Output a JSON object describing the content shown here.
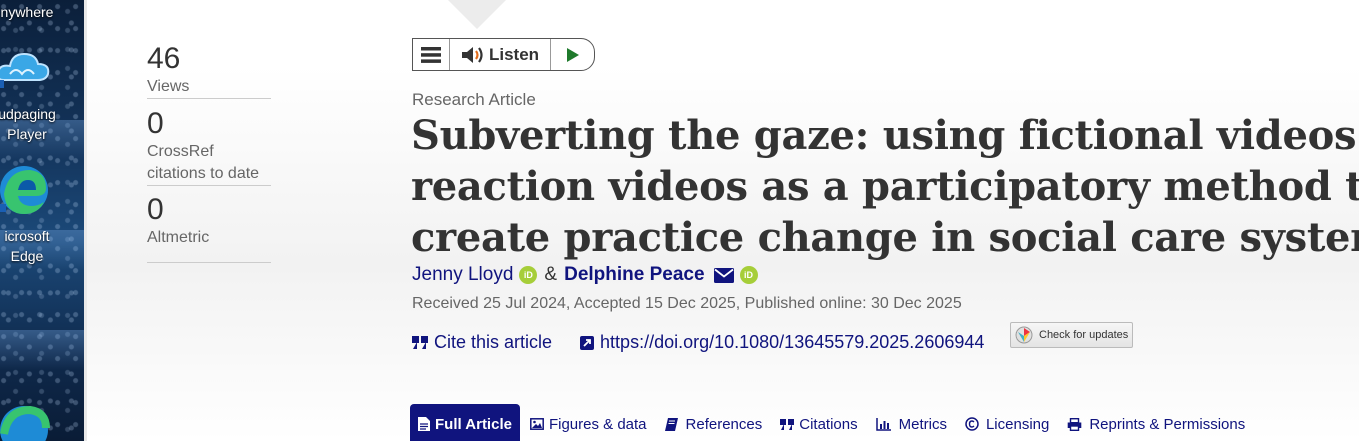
{
  "desktop": {
    "icons": [
      {
        "label": "nywhere",
        "icon": "app-icon"
      },
      {
        "label": "udpaging\nPlayer",
        "icon": "cloud-icon"
      },
      {
        "label": "icrosoft\nEdge",
        "icon": "edge-icon"
      },
      {
        "label": "",
        "icon": "edge-icon"
      }
    ]
  },
  "metrics": [
    {
      "value": "46",
      "label": "Views"
    },
    {
      "value": "0",
      "label": "CrossRef citations to date"
    },
    {
      "value": "0",
      "label": "Altmetric"
    }
  ],
  "listen": {
    "label": "Listen"
  },
  "article": {
    "type": "Research Article",
    "title": "Subverting the gaze: using fictional videos and reaction videos as a participatory method to create practice change in social care systems",
    "authors": [
      {
        "name": "Jenny Lloyd",
        "orcid": true,
        "email": false
      },
      {
        "name": "Delphine Peace",
        "orcid": true,
        "email": true
      }
    ],
    "author_separator": "&",
    "dates": "Received 25 Jul 2024, Accepted 15 Dec 2025, Published online: 30 Dec 2025",
    "cite_label": "Cite this article",
    "doi": "https://doi.org/10.1080/13645579.2025.2606944",
    "check_updates": "Check for updates"
  },
  "tabs": [
    {
      "label": "Full Article",
      "icon": "document-icon",
      "active": true
    },
    {
      "label": "Figures & data",
      "icon": "image-icon",
      "active": false
    },
    {
      "label": "References",
      "icon": "book-icon",
      "active": false
    },
    {
      "label": "Citations",
      "icon": "quote-icon",
      "active": false
    },
    {
      "label": "Metrics",
      "icon": "bar-chart-icon",
      "active": false
    },
    {
      "label": "Licensing",
      "icon": "copyright-icon",
      "active": false
    },
    {
      "label": "Reprints & Permissions",
      "icon": "print-icon",
      "active": false
    }
  ],
  "colors": {
    "link": "#10147e",
    "orcid": "#a6ce39",
    "active_tab": "#10147e"
  }
}
